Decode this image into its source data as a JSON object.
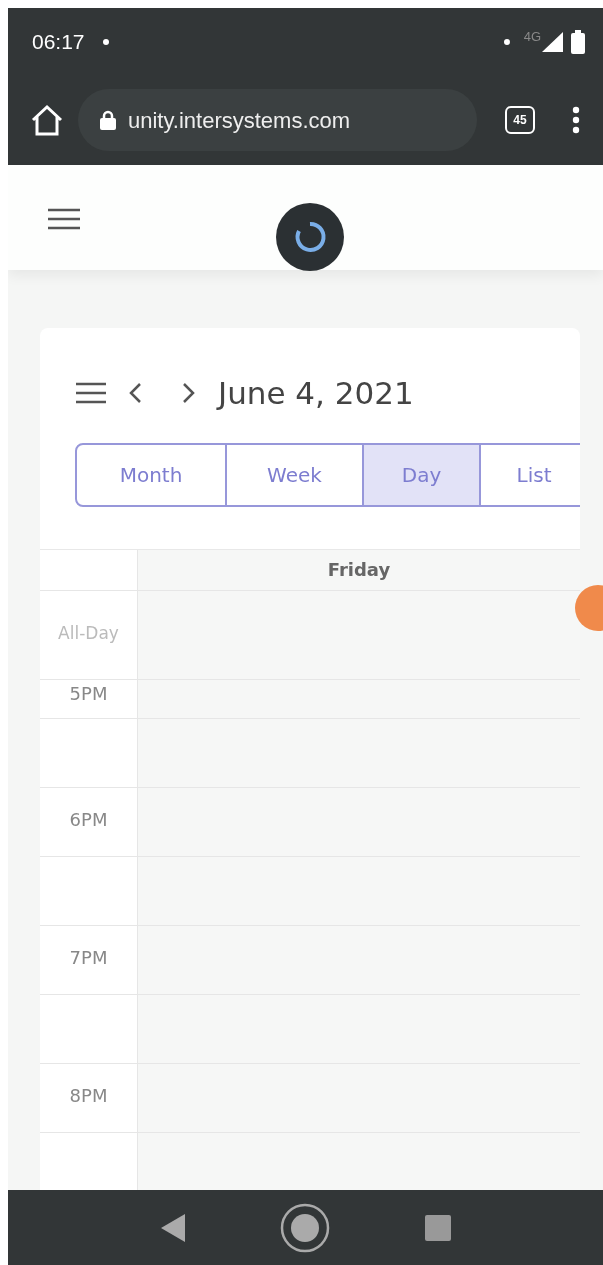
{
  "status_bar": {
    "time": "06:17",
    "network": "4G"
  },
  "browser": {
    "url": "unity.intersystems.com",
    "tab_count": "45"
  },
  "calendar": {
    "title": "June 4, 2021",
    "views": [
      {
        "label": "Month",
        "selected": false
      },
      {
        "label": "Week",
        "selected": false
      },
      {
        "label": "Day",
        "selected": true
      },
      {
        "label": "List",
        "selected": false
      }
    ],
    "day_header": "Friday",
    "all_day_label": "All-Day",
    "hours": [
      {
        "label": "5PM"
      },
      {
        "label": "6PM"
      },
      {
        "label": "7PM"
      },
      {
        "label": "8PM"
      }
    ]
  }
}
